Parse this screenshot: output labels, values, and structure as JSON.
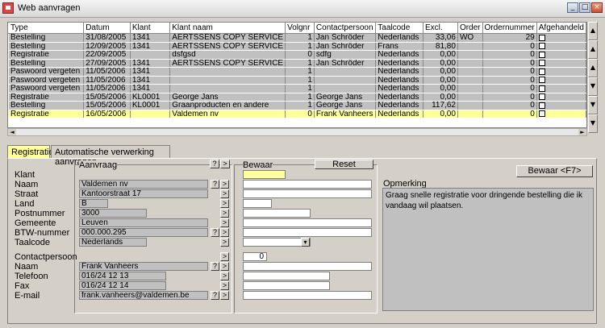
{
  "window": {
    "title": "Web aanvragen",
    "min": "_",
    "max": "□",
    "close": "×"
  },
  "grid": {
    "columns": [
      "Type",
      "Datum",
      "Klant",
      "Klant naam",
      "Volgnr",
      "Contactpersoon",
      "Taalcode",
      "Excl.",
      "Order",
      "Ordernummer",
      "Afgehandeld"
    ],
    "rows": [
      [
        "Bestelling",
        "31/08/2005",
        "1341",
        "AERTSSENS COPY SERVICE",
        "1",
        "Jan Schröder",
        "Nederlands",
        "33,06",
        "WO",
        "29",
        ""
      ],
      [
        "Bestelling",
        "12/09/2005",
        "1341",
        "AERTSSENS COPY SERVICE",
        "1",
        "Jan Schröder",
        "Frans",
        "81,80",
        "",
        "0",
        ""
      ],
      [
        "Registratie",
        "22/09/2005",
        "",
        "dsfgsd",
        "0",
        "sdfg",
        "Nederlands",
        "0,00",
        "",
        "0",
        ""
      ],
      [
        "Bestelling",
        "27/09/2005",
        "1341",
        "AERTSSENS COPY SERVICE",
        "1",
        "Jan Schröder",
        "Nederlands",
        "0,00",
        "",
        "0",
        ""
      ],
      [
        "Paswoord vergeten",
        "11/05/2006",
        "1341",
        "",
        "1",
        "",
        "Nederlands",
        "0,00",
        "",
        "0",
        ""
      ],
      [
        "Paswoord vergeten",
        "11/05/2006",
        "1341",
        "",
        "1",
        "",
        "Nederlands",
        "0,00",
        "",
        "0",
        ""
      ],
      [
        "Paswoord vergeten",
        "11/05/2006",
        "1341",
        "",
        "1",
        "",
        "Nederlands",
        "0,00",
        "",
        "0",
        ""
      ],
      [
        "Registratie",
        "15/05/2006",
        "KL0001",
        "George Jans",
        "1",
        "George Jans",
        "Nederlands",
        "0,00",
        "",
        "0",
        ""
      ],
      [
        "Bestelling",
        "15/05/2006",
        "KL0001",
        "Graanproducten en andere",
        "1",
        "George Jans",
        "Nederlands",
        "117,62",
        "",
        "0",
        ""
      ],
      [
        "Registratie",
        "16/05/2006",
        "",
        "Valdemen nv",
        "0",
        "Frank Vanheers",
        "Nederlands",
        "0,00",
        "",
        "0",
        ""
      ]
    ],
    "selected_row": 9
  },
  "scroll": {
    "top": "▲",
    "up2": "▲",
    "up": "▲",
    "down": "▼",
    "down2": "▼",
    "bottom": "▼",
    "left": "◄",
    "right": "►"
  },
  "tabs": [
    "Registratie",
    "Automatische verwerking aanvragen"
  ],
  "form": {
    "aanvraag_title": "Aanvraag",
    "bewaar_title": "Bewaar",
    "reset": "Reset",
    "bewaar_f7": "Bewaar <F7>",
    "opmerking_label": "Opmerking",
    "labels": {
      "klant": "Klant",
      "naam": "Naam",
      "straat": "Straat",
      "land": "Land",
      "postnummer": "Postnummer",
      "gemeente": "Gemeente",
      "btw": "BTW-nummer",
      "taalcode": "Taalcode",
      "contactpersoon": "Contactpersoon",
      "cnaam": "Naam",
      "telefoon": "Telefoon",
      "fax": "Fax",
      "email": "E-mail"
    },
    "values": {
      "naam": "Valdemen nv",
      "straat": "Kantoorstraat 17",
      "land": "B",
      "postnummer": "3000",
      "gemeente": "Leuven",
      "btw": "000.000.295",
      "taalcode": "Nederlands",
      "cnaam": "Frank Vanheers",
      "telefoon": "016/24 12 13",
      "fax": "016/24 12 14",
      "email": "frank.vanheers@valdemen.be"
    },
    "contact_count": "0",
    "q": "?",
    "arrow": ">",
    "dropdown": "▾",
    "opmerking": "Graag snelle registratie voor dringende bestelling die ik vandaag wil plaatsen."
  }
}
